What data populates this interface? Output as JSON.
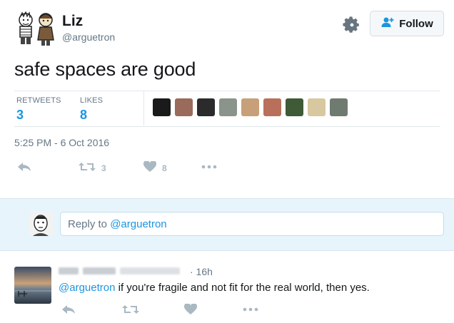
{
  "user": {
    "name": "Liz",
    "handle": "@arguetron",
    "follow_label": "Follow"
  },
  "tweet": {
    "text": "safe spaces are good",
    "retweets_label": "RETWEETS",
    "retweets_count": "3",
    "likes_label": "LIKES",
    "likes_count": "8",
    "timestamp": "5:25 PM - 6 Oct 2016",
    "actions": {
      "retweet_count": "3",
      "like_count": "8"
    }
  },
  "liker_avatars": [
    {
      "name": "liker-avatar-1",
      "color": "#1a1a1a"
    },
    {
      "name": "liker-avatar-2",
      "color": "#9a6a5a"
    },
    {
      "name": "liker-avatar-3",
      "color": "#2b2b2b"
    },
    {
      "name": "liker-avatar-4",
      "color": "#8a948a"
    },
    {
      "name": "liker-avatar-5",
      "color": "#c7a07a"
    },
    {
      "name": "liker-avatar-6",
      "color": "#b8705a"
    },
    {
      "name": "liker-avatar-7",
      "color": "#3f5a36"
    },
    {
      "name": "liker-avatar-8",
      "color": "#d8c8a0"
    },
    {
      "name": "liker-avatar-9",
      "color": "#6f7a70"
    }
  ],
  "reply_box": {
    "prefix": "Reply to ",
    "mention": "@arguetron"
  },
  "reply": {
    "time": "· 16h",
    "mention": "@arguetron",
    "text": " if you're fragile and not fit for the real world, then yes."
  },
  "colors": {
    "accent": "#1b95e0",
    "muted": "#657786",
    "reply_bg": "#e8f4fb"
  }
}
